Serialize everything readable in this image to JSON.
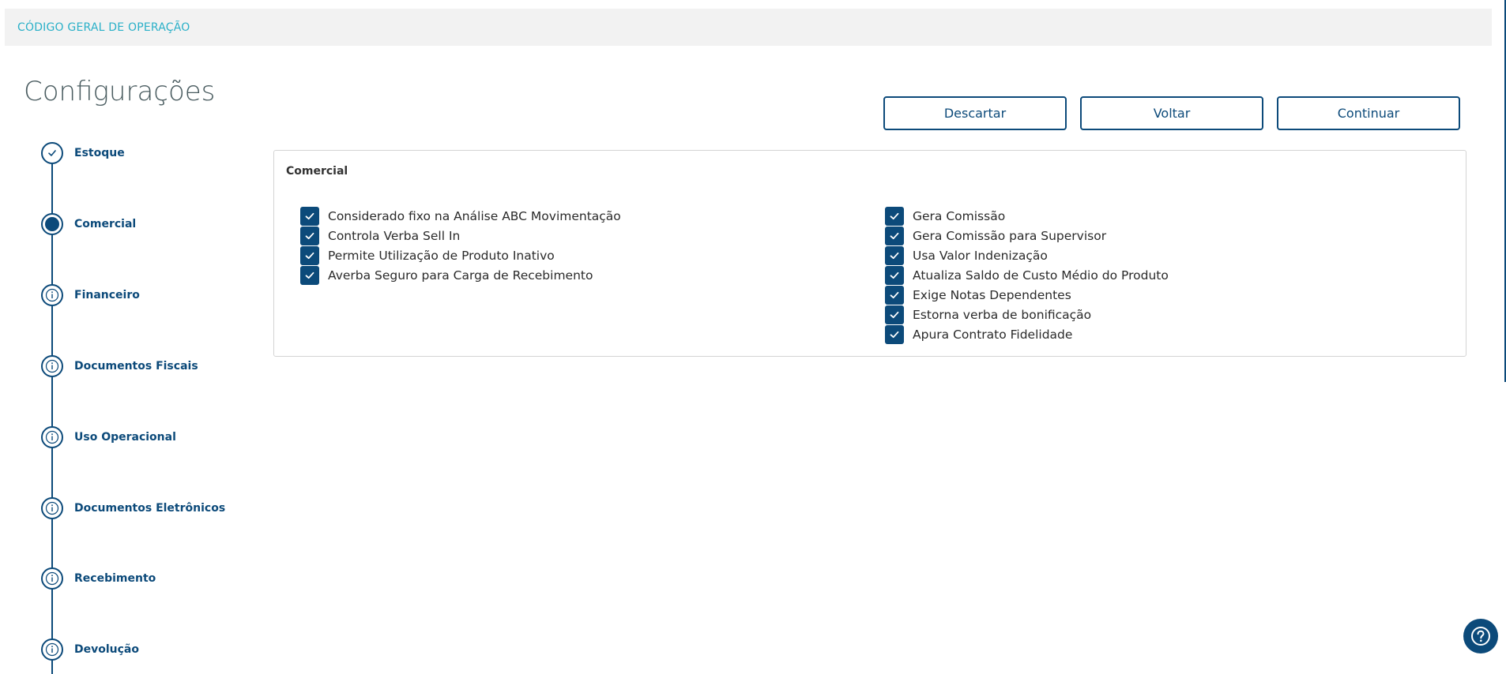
{
  "breadcrumb": {
    "label": "CÓDIGO GERAL DE OPERAÇÃO"
  },
  "page": {
    "title": "Configurações"
  },
  "actions": {
    "discard_label": "Descartar",
    "back_label": "Voltar",
    "continue_label": "Continuar"
  },
  "stepper": {
    "steps": [
      {
        "label": "Estoque",
        "state": "done",
        "icon": "check-icon"
      },
      {
        "label": "Comercial",
        "state": "active",
        "icon": "dot-icon"
      },
      {
        "label": "Financeiro",
        "state": "pending",
        "icon": "info-icon"
      },
      {
        "label": "Documentos Fiscais",
        "state": "pending",
        "icon": "info-icon"
      },
      {
        "label": "Uso Operacional",
        "state": "pending",
        "icon": "info-icon"
      },
      {
        "label": "Documentos Eletrônicos",
        "state": "pending",
        "icon": "info-icon"
      },
      {
        "label": "Recebimento",
        "state": "pending",
        "icon": "info-icon"
      },
      {
        "label": "Devolução",
        "state": "pending",
        "icon": "info-icon"
      }
    ]
  },
  "panel": {
    "title": "Comercial",
    "left_options": [
      {
        "label": "Considerado fixo na Análise ABC Movimentação",
        "checked": true
      },
      {
        "label": "Controla Verba Sell In",
        "checked": true
      },
      {
        "label": "Permite Utilização de Produto Inativo",
        "checked": true
      },
      {
        "label": "Averba Seguro para Carga de Recebimento",
        "checked": true
      }
    ],
    "right_options": [
      {
        "label": "Gera Comissão",
        "checked": true
      },
      {
        "label": "Gera Comissão para Supervisor",
        "checked": true
      },
      {
        "label": "Usa Valor Indenização",
        "checked": true
      },
      {
        "label": "Atualiza Saldo de Custo Médio do Produto",
        "checked": true
      },
      {
        "label": "Exige Notas Dependentes",
        "checked": true
      },
      {
        "label": "Estorna verba de bonificação",
        "checked": true
      },
      {
        "label": "Apura Contrato Fidelidade",
        "checked": true
      }
    ]
  },
  "help": {
    "icon": "help-icon"
  },
  "colors": {
    "primary": "#0c4a7a",
    "breadcrumb": "#2ab0c8",
    "title": "#4a5c60"
  }
}
